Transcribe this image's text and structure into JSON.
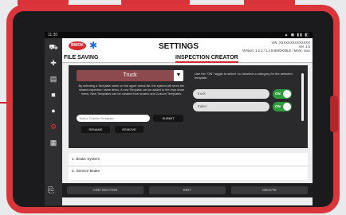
{
  "status_bar": {
    "time": "11:30",
    "system_icons": "▲ ◼ ▮▮ ◧"
  },
  "header": {
    "logo_text": "BWOK",
    "title": "SETTINGS",
    "version_line1": "VIN: XXXXXXXXXXXXXX",
    "version_line2": "Ver. 1.5",
    "version_line3": "Version: 1.2.3 / 1.4.5 BWOK/BLE / More: xxxx"
  },
  "tabs": [
    {
      "label": "FILE SAVING"
    },
    {
      "label": "INSPECTION CREATOR"
    }
  ],
  "inspection_creator": {
    "selected_template": "Truck",
    "help_text": "By selecting a Template name on the upper select list, the system will show the related inspection name items. A new Template can be added to the drop down menu. New Templates can be created from scratch and Custom Templates.",
    "custom_input_placeholder": "Add a Custom Template",
    "submit_label": "SUBMIT",
    "rename_label": "RENAME",
    "remove_label": "REMOVE",
    "right_info": "Use the \"ON\" toggle to select / to deselect a category for the selected template.",
    "toggles": [
      {
        "label": "truck",
        "state": "ON"
      },
      {
        "label": "trailer",
        "state": "ON"
      }
    ]
  },
  "list": {
    "items": [
      "1. Brake System",
      "2. Service Brake"
    ]
  },
  "bottom_buttons": [
    "ADD SECTION",
    "EDIT",
    "DELETE"
  ],
  "colors": {
    "case": "#d9353b",
    "accent": "#d02a30",
    "toggle_on": "#2e9b3d",
    "dropdown": "#8e4b4f"
  },
  "icons": {
    "rail": [
      "truck-icon",
      "wrench-icon",
      "clipboard-icon",
      "folder-icon",
      "pin-icon",
      "gear-icon",
      "document-icon"
    ],
    "bottom": "paperclip-icon"
  }
}
